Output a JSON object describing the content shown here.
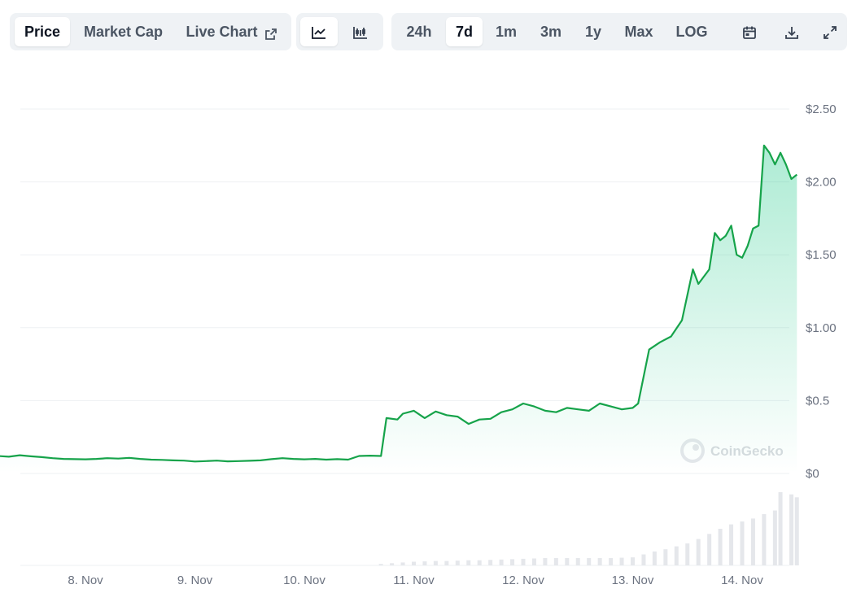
{
  "toolbar": {
    "view_tabs": [
      "Price",
      "Market Cap",
      "Live Chart"
    ],
    "active_view": "Price",
    "chart_types": [
      "line-chart-icon",
      "candlestick-chart-icon"
    ],
    "active_chart_type": "line-chart-icon",
    "ranges": [
      "24h",
      "7d",
      "1m",
      "3m",
      "1y",
      "Max",
      "LOG"
    ],
    "active_range": "7d",
    "tools": [
      "calendar-icon",
      "download-icon",
      "fullscreen-icon"
    ]
  },
  "watermark": "CoinGecko",
  "colors": {
    "line": "#16a34a",
    "fill_top": "#16c784",
    "volume": "#e5e7eb",
    "grid": "#eef0f3"
  },
  "chart_data": {
    "type": "line",
    "title": "",
    "xlabel": "",
    "ylabel": "",
    "x_ticks": [
      "8. Nov",
      "9. Nov",
      "10. Nov",
      "11. Nov",
      "12. Nov",
      "13. Nov",
      "14. Nov"
    ],
    "y_ticks": [
      "$0",
      "$0.5",
      "$1.00",
      "$1.50",
      "$2.00",
      "$2.50"
    ],
    "ylim": [
      0,
      2.5
    ],
    "x_range": [
      0.0,
      7.0
    ],
    "grid": true,
    "series": [
      {
        "values": [
          [
            0.0,
            0.125
          ],
          [
            0.1,
            0.11
          ],
          [
            0.2,
            0.12
          ],
          [
            0.3,
            0.115
          ],
          [
            0.4,
            0.125
          ],
          [
            0.5,
            0.118
          ],
          [
            0.6,
            0.112
          ],
          [
            0.7,
            0.105
          ],
          [
            0.8,
            0.1
          ],
          [
            0.9,
            0.098
          ],
          [
            1.0,
            0.097
          ],
          [
            1.1,
            0.1
          ],
          [
            1.2,
            0.105
          ],
          [
            1.3,
            0.102
          ],
          [
            1.4,
            0.107
          ],
          [
            1.5,
            0.1
          ],
          [
            1.6,
            0.095
          ],
          [
            1.7,
            0.093
          ],
          [
            1.8,
            0.09
          ],
          [
            1.9,
            0.088
          ],
          [
            2.0,
            0.082
          ],
          [
            2.1,
            0.085
          ],
          [
            2.2,
            0.088
          ],
          [
            2.3,
            0.083
          ],
          [
            2.4,
            0.085
          ],
          [
            2.5,
            0.087
          ],
          [
            2.6,
            0.09
          ],
          [
            2.7,
            0.098
          ],
          [
            2.8,
            0.105
          ],
          [
            2.9,
            0.1
          ],
          [
            3.0,
            0.097
          ],
          [
            3.1,
            0.1
          ],
          [
            3.2,
            0.095
          ],
          [
            3.3,
            0.098
          ],
          [
            3.4,
            0.095
          ],
          [
            3.5,
            0.12
          ],
          [
            3.6,
            0.122
          ],
          [
            3.7,
            0.12
          ],
          [
            3.75,
            0.38
          ],
          [
            3.85,
            0.37
          ],
          [
            3.9,
            0.41
          ],
          [
            4.0,
            0.43
          ],
          [
            4.1,
            0.38
          ],
          [
            4.2,
            0.425
          ],
          [
            4.3,
            0.4
          ],
          [
            4.4,
            0.39
          ],
          [
            4.5,
            0.34
          ],
          [
            4.6,
            0.37
          ],
          [
            4.7,
            0.375
          ],
          [
            4.8,
            0.42
          ],
          [
            4.9,
            0.44
          ],
          [
            5.0,
            0.48
          ],
          [
            5.1,
            0.46
          ],
          [
            5.2,
            0.43
          ],
          [
            5.3,
            0.42
          ],
          [
            5.4,
            0.45
          ],
          [
            5.5,
            0.44
          ],
          [
            5.6,
            0.43
          ],
          [
            5.7,
            0.48
          ],
          [
            5.8,
            0.46
          ],
          [
            5.9,
            0.44
          ],
          [
            6.0,
            0.45
          ],
          [
            6.05,
            0.48
          ],
          [
            6.15,
            0.85
          ],
          [
            6.25,
            0.9
          ],
          [
            6.35,
            0.94
          ],
          [
            6.45,
            1.05
          ],
          [
            6.55,
            1.4
          ],
          [
            6.6,
            1.3
          ],
          [
            6.7,
            1.4
          ],
          [
            6.75,
            1.65
          ],
          [
            6.8,
            1.6
          ],
          [
            6.85,
            1.63
          ],
          [
            6.9,
            1.7
          ],
          [
            6.95,
            1.5
          ],
          [
            7.0,
            1.48
          ],
          [
            7.05,
            1.56
          ],
          [
            7.1,
            1.68
          ],
          [
            7.15,
            1.7
          ],
          [
            7.2,
            2.25
          ],
          [
            7.25,
            2.2
          ],
          [
            7.3,
            2.12
          ],
          [
            7.35,
            2.2
          ],
          [
            7.4,
            2.12
          ],
          [
            7.45,
            2.02
          ],
          [
            7.5,
            2.05
          ]
        ]
      }
    ],
    "volume": [
      [
        3.7,
        0.02
      ],
      [
        3.8,
        0.03
      ],
      [
        3.9,
        0.04
      ],
      [
        4.0,
        0.05
      ],
      [
        4.1,
        0.055
      ],
      [
        4.2,
        0.06
      ],
      [
        4.3,
        0.06
      ],
      [
        4.4,
        0.065
      ],
      [
        4.5,
        0.07
      ],
      [
        4.6,
        0.07
      ],
      [
        4.7,
        0.075
      ],
      [
        4.8,
        0.08
      ],
      [
        4.9,
        0.085
      ],
      [
        5.0,
        0.09
      ],
      [
        5.1,
        0.095
      ],
      [
        5.2,
        0.1
      ],
      [
        5.3,
        0.1
      ],
      [
        5.4,
        0.1
      ],
      [
        5.5,
        0.1
      ],
      [
        5.6,
        0.1
      ],
      [
        5.7,
        0.1
      ],
      [
        5.8,
        0.1
      ],
      [
        5.9,
        0.105
      ],
      [
        6.0,
        0.11
      ],
      [
        6.1,
        0.15
      ],
      [
        6.2,
        0.19
      ],
      [
        6.3,
        0.22
      ],
      [
        6.4,
        0.26
      ],
      [
        6.5,
        0.3
      ],
      [
        6.6,
        0.36
      ],
      [
        6.7,
        0.43
      ],
      [
        6.8,
        0.5
      ],
      [
        6.9,
        0.56
      ],
      [
        7.0,
        0.6
      ],
      [
        7.1,
        0.64
      ],
      [
        7.2,
        0.7
      ],
      [
        7.3,
        0.75
      ],
      [
        7.35,
        1.0
      ],
      [
        7.45,
        0.97
      ],
      [
        7.5,
        0.93
      ]
    ]
  }
}
